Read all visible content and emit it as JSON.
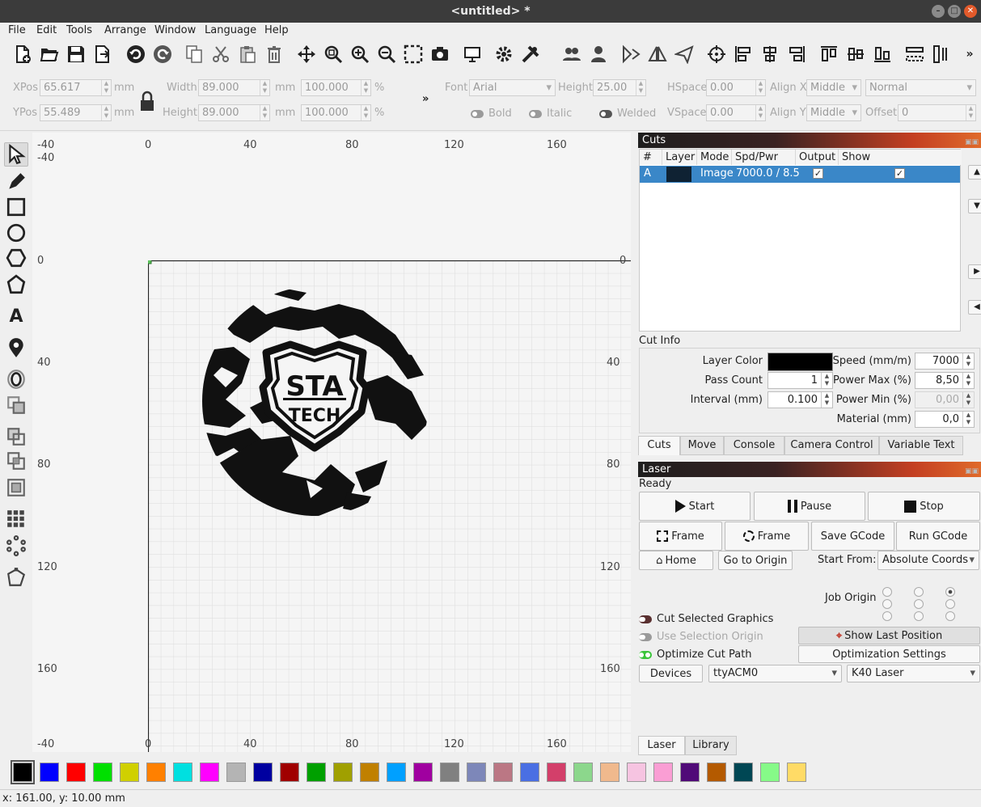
{
  "window": {
    "title": "<untitled> *"
  },
  "menu": [
    "File",
    "Edit",
    "Tools",
    "Arrange",
    "Window",
    "Language",
    "Help"
  ],
  "props": {
    "xpos_label": "XPos",
    "xpos": "65.617",
    "ypos_label": "YPos",
    "ypos": "55.489",
    "mm": "mm",
    "width_label": "Width",
    "width": "89.000",
    "height_label": "Height",
    "height": "89.000",
    "pct_w": "100.000",
    "pct_h": "100.000",
    "pct": "%",
    "font_label": "Font",
    "font": "Arial",
    "fheight_label": "Height",
    "fheight": "25.00",
    "hspace_label": "HSpace",
    "hspace": "0.00",
    "vspace_label": "VSpace",
    "vspace": "0.00",
    "alignx_label": "Align X",
    "alignx": "Middle",
    "aligny_label": "Align Y",
    "aligny": "Middle",
    "style": "Normal",
    "offset_label": "Offset",
    "offset": "0",
    "bold": "Bold",
    "italic": "Italic",
    "welded": "Welded",
    "more": "»"
  },
  "rulers": {
    "top": [
      "-40",
      "0",
      "40",
      "80",
      "120",
      "160"
    ],
    "left": [
      "-40",
      "0",
      "40",
      "80",
      "120",
      "160"
    ],
    "left_top": "-40",
    "left_bottom": "-40",
    "right": [
      "0",
      "40",
      "80",
      "120",
      "160"
    ],
    "bottom": [
      "0",
      "40",
      "80",
      "120",
      "160"
    ]
  },
  "cuts": {
    "title": "Cuts",
    "headers": [
      "#",
      "Layer",
      "Mode",
      "Spd/Pwr",
      "Output",
      "Show"
    ],
    "row": {
      "id": "A",
      "mode": "Image",
      "spdpwr": "7000.0 / 8.5",
      "output": "✓",
      "show": "✓"
    },
    "layer_color": "#0f2233"
  },
  "cutinfo": {
    "title": "Cut Info",
    "layer_color_label": "Layer Color",
    "pass_label": "Pass Count",
    "pass": "1",
    "interval_label": "Interval (mm)",
    "interval": "0.100",
    "speed_label": "Speed (mm/m)",
    "speed": "7000",
    "pmax_label": "Power Max (%)",
    "pmax": "8,50",
    "pmin_label": "Power Min (%)",
    "pmin": "0,00",
    "material_label": "Material (mm)",
    "material": "0,0"
  },
  "tabs": [
    "Cuts",
    "Move",
    "Console",
    "Camera Control",
    "Variable Text"
  ],
  "laser": {
    "title": "Laser",
    "status": "Ready",
    "start": "Start",
    "pause": "Pause",
    "stop": "Stop",
    "frame1": "Frame",
    "frame2": "Frame",
    "save_gcode": "Save GCode",
    "run_gcode": "Run GCode",
    "home": "Home",
    "goto_origin": "Go to Origin",
    "start_from_label": "Start From:",
    "start_from": "Absolute Coords",
    "job_origin_label": "Job Origin",
    "cut_selected": "Cut Selected Graphics",
    "use_sel_origin": "Use Selection Origin",
    "optimize": "Optimize Cut Path",
    "show_last": "Show Last Position",
    "opt_settings": "Optimization Settings",
    "devices": "Devices",
    "port": "ttyACM0",
    "device": "K40 Laser"
  },
  "bottom_tabs": [
    "Laser",
    "Library"
  ],
  "palette": [
    "#000000",
    "#0000ff",
    "#ff0000",
    "#00e000",
    "#d0d000",
    "#ff8000",
    "#00e0e0",
    "#ff00ff",
    "#b4b4b4",
    "#0000a0",
    "#a00000",
    "#00a000",
    "#a0a000",
    "#c08000",
    "#00a0ff",
    "#a000a0",
    "#808080",
    "#7d87b9",
    "#bb7784",
    "#4a6fe3",
    "#d33f6a",
    "#8cd78c",
    "#f0b98d",
    "#f6c4e1",
    "#fa9ed4",
    "#500a78",
    "#b45a00",
    "#004754",
    "#86fa88",
    "#ffdb66"
  ],
  "statusbar": "x: 161.00, y: 10.00 mm"
}
